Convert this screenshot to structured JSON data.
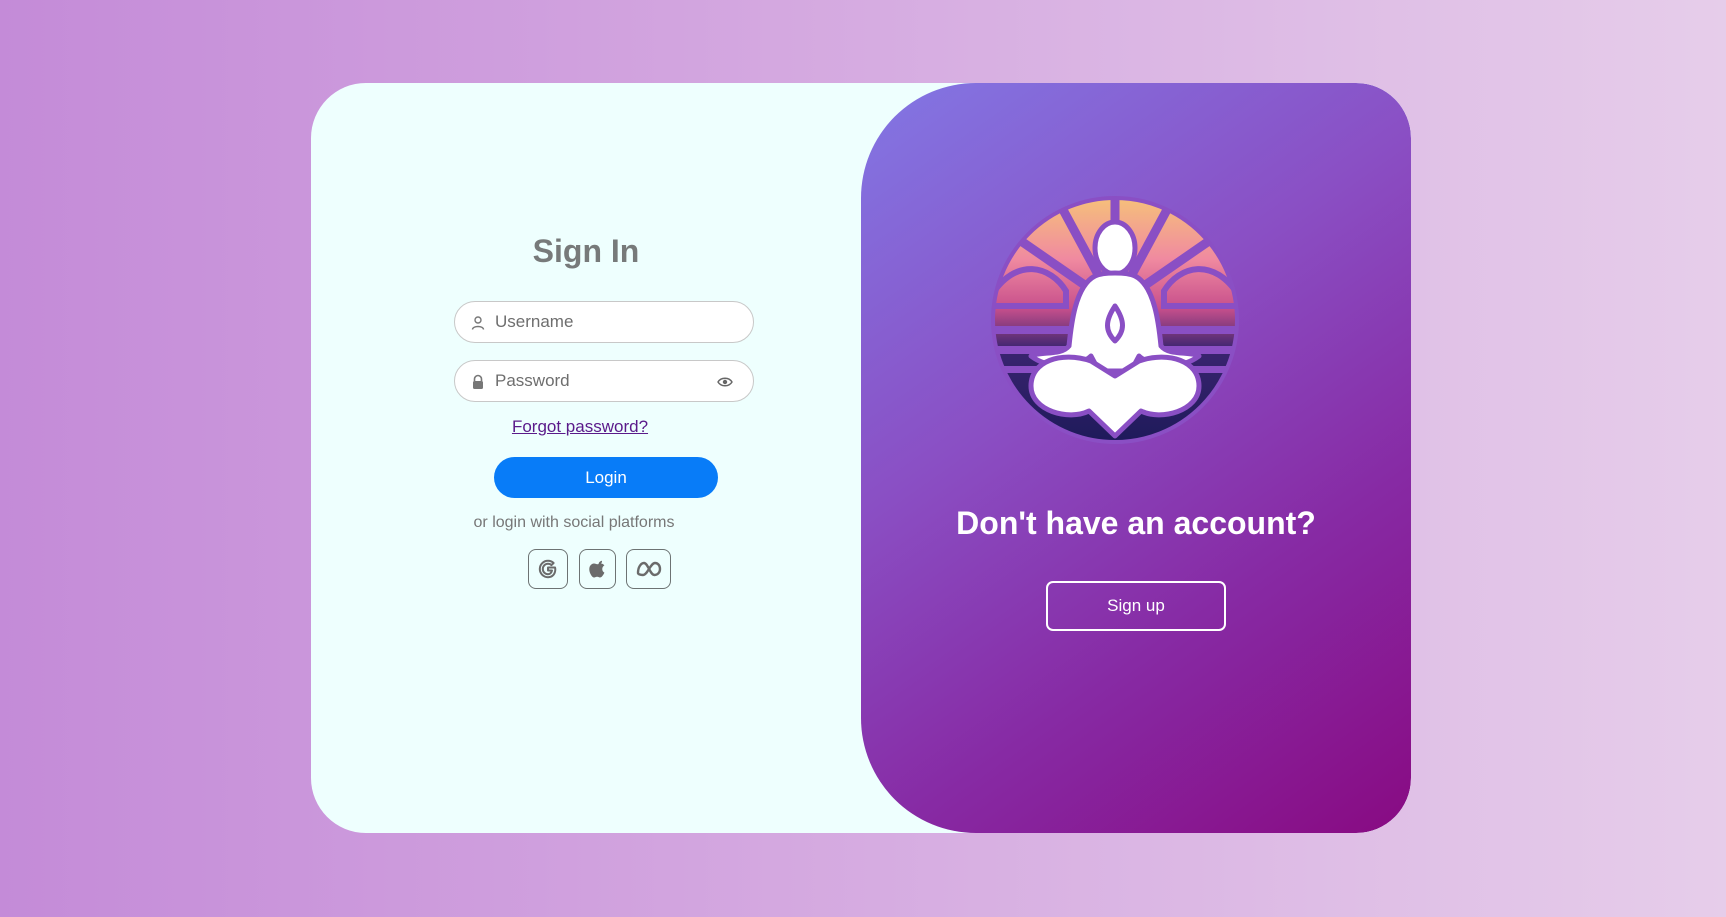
{
  "signin": {
    "title": "Sign In",
    "username_placeholder": "Username",
    "password_placeholder": "Password",
    "forgot_label": "Forgot password?",
    "login_label": "Login",
    "social_text": "or login with social platforms",
    "social_icons": [
      "google-icon",
      "apple-icon",
      "meta-icon"
    ]
  },
  "signup_panel": {
    "heading": "Don't have an account?",
    "signup_label": "Sign up",
    "logo_icon": "meditation-logo"
  },
  "colors": {
    "login_button": "#087cf8",
    "panel_gradient_start": "#8277e4",
    "panel_gradient_end": "#880a82",
    "card_background": "#eefffe",
    "link": "#5a1a8a"
  }
}
